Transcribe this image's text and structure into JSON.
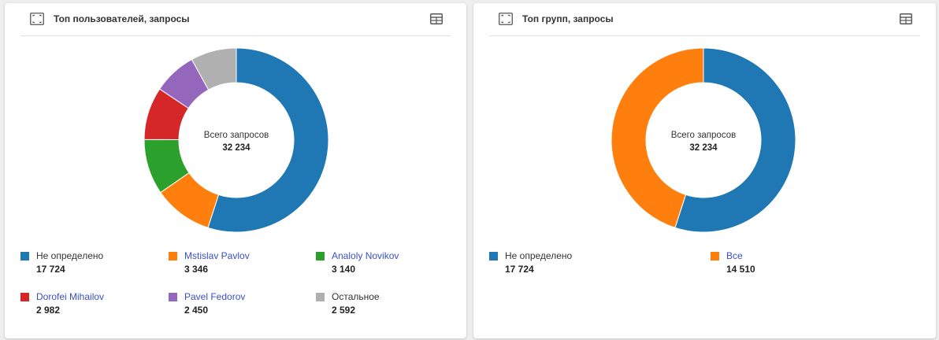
{
  "colors": {
    "blue": "#1f77b4",
    "orange": "#ff7f0e",
    "green": "#2ca02c",
    "red": "#d62728",
    "purple": "#9467bd",
    "gray": "#b0b0b0",
    "link": "#3a4fc7"
  },
  "panels": [
    {
      "title": "Топ пользователей, запросы",
      "center_label": "Всего запросов",
      "center_value": "32 234",
      "icons": [
        "expand-icon",
        "table-icon"
      ],
      "legend": [
        {
          "label": "Не определено",
          "value": "17 724",
          "color": "#1f77b4",
          "link": false
        },
        {
          "label": "Mstislav Pavlov",
          "value": "3 346",
          "color": "#ff7f0e",
          "link": true
        },
        {
          "label": "Analoly Novikov",
          "value": "3 140",
          "color": "#2ca02c",
          "link": true
        },
        {
          "label": "Dorofei Mihailov",
          "value": "2 982",
          "color": "#d62728",
          "link": true
        },
        {
          "label": "Pavel Fedorov",
          "value": "2 450",
          "color": "#9467bd",
          "link": true
        },
        {
          "label": "Остальное",
          "value": "2 592",
          "color": "#b0b0b0",
          "link": false
        }
      ]
    },
    {
      "title": "Топ групп, запросы",
      "center_label": "Всего запросов",
      "center_value": "32 234",
      "icons": [
        "expand-icon",
        "table-icon"
      ],
      "legend": [
        {
          "label": "Не определено",
          "value": "17 724",
          "color": "#1f77b4",
          "link": false
        },
        {
          "label": "Все",
          "value": "14 510",
          "color": "#ff7f0e",
          "link": true
        }
      ]
    }
  ],
  "chart_data": [
    {
      "type": "pie",
      "variant": "donut",
      "title": "Топ пользователей, запросы",
      "center_text": "Всего запросов",
      "total": 32234,
      "categories": [
        "Не определено",
        "Mstislav Pavlov",
        "Analoly Novikov",
        "Dorofei Mihailov",
        "Pavel Fedorov",
        "Остальное"
      ],
      "values": [
        17724,
        3346,
        3140,
        2982,
        2450,
        2592
      ],
      "colors": [
        "#1f77b4",
        "#ff7f0e",
        "#2ca02c",
        "#d62728",
        "#9467bd",
        "#b0b0b0"
      ],
      "legend": "bottom"
    },
    {
      "type": "pie",
      "variant": "donut",
      "title": "Топ групп, запросы",
      "center_text": "Всего запросов",
      "total": 32234,
      "categories": [
        "Не определено",
        "Все"
      ],
      "values": [
        17724,
        14510
      ],
      "colors": [
        "#1f77b4",
        "#ff7f0e"
      ],
      "legend": "bottom"
    }
  ]
}
